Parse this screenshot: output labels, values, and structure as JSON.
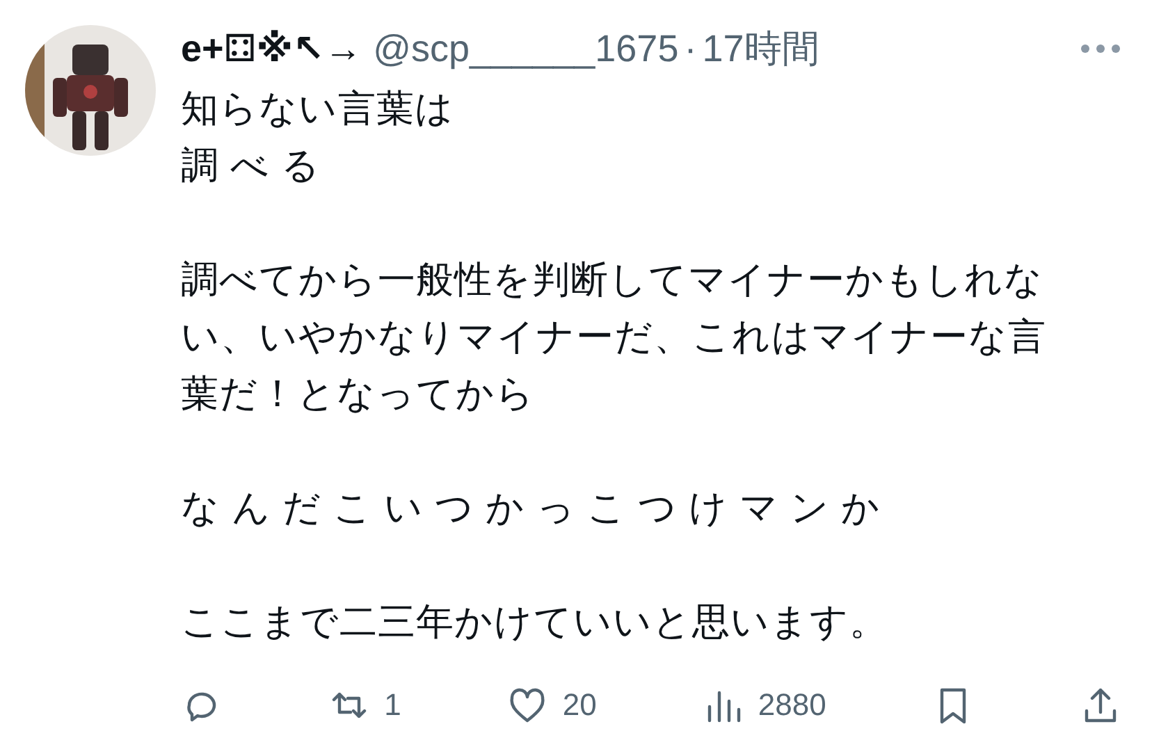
{
  "post": {
    "display_name": "e+⚃※↖→",
    "handle": "@scp______1675",
    "separator": "·",
    "time": "17時間",
    "paragraphs": [
      [
        "知らない言葉は",
        "調 べ る"
      ],
      [
        "調べてから一般性を判断してマイナーかもしれな",
        "い、いやかなりマイナーだ、これはマイナーな言",
        "葉だ！となってから"
      ],
      [
        "な ん だ こ い つ か っ こ つ け マ ン か"
      ],
      [
        "ここまで二三年かけていいと思います。"
      ]
    ],
    "actions": [
      {
        "kind": "reply"
      },
      {
        "kind": "repost",
        "count": "1"
      },
      {
        "kind": "like",
        "count": "20"
      },
      {
        "kind": "views",
        "count": "2880"
      },
      {
        "kind": "bookmark"
      },
      {
        "kind": "share"
      }
    ]
  }
}
